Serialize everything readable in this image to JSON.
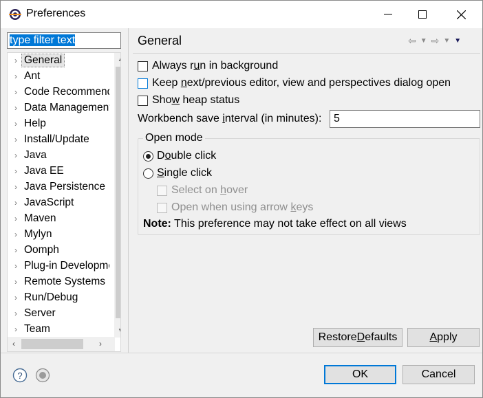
{
  "window": {
    "title": "Preferences",
    "minimize_icon": "minimize-icon",
    "maximize_icon": "maximize-icon",
    "close_icon": "close-icon"
  },
  "filter": {
    "value": "type filter text"
  },
  "tree": {
    "selected": "General",
    "items": [
      "General",
      "Ant",
      "Code Recommenders",
      "Data Management",
      "Help",
      "Install/Update",
      "Java",
      "Java EE",
      "Java Persistence",
      "JavaScript",
      "Maven",
      "Mylyn",
      "Oomph",
      "Plug-in Development",
      "Remote Systems",
      "Run/Debug",
      "Server",
      "Team"
    ]
  },
  "page": {
    "title": "General",
    "checkboxes": {
      "always_run_background": {
        "before": "Always r",
        "mnemonic": "u",
        "after": "n in background",
        "checked": false
      },
      "keep_next_prev": {
        "before": "Keep ",
        "mnemonic": "n",
        "after": "ext/previous editor, view and perspectives dialog open",
        "checked": false
      },
      "show_heap": {
        "before": "Sho",
        "mnemonic": "w",
        "after": " heap status",
        "checked": false
      }
    },
    "interval": {
      "before": "Workbench save ",
      "mnemonic": "i",
      "after": "nterval (in minutes):",
      "value": "5"
    },
    "open_mode": {
      "label": "Open mode",
      "double_click": {
        "before": "D",
        "mnemonic": "o",
        "after": "uble click",
        "checked": true
      },
      "single_click": {
        "before": "",
        "mnemonic": "S",
        "after": "ingle click",
        "checked": false
      },
      "select_on_hover": {
        "before": "Select on ",
        "mnemonic": "h",
        "after": "over",
        "enabled": false
      },
      "open_arrow_keys": {
        "before": "Open when using arrow ",
        "mnemonic": "k",
        "after": "eys",
        "enabled": false
      }
    },
    "note": {
      "bold": "Note:",
      "text": " This preference may not take effect on all views"
    }
  },
  "buttons": {
    "restore_defaults": {
      "before": "Restore ",
      "mnemonic": "D",
      "after": "efaults"
    },
    "apply": {
      "before": "",
      "mnemonic": "A",
      "after": "pply"
    },
    "ok": "OK",
    "cancel": "Cancel"
  },
  "icons": {
    "help": "help-icon",
    "info": "info-icon",
    "back": "back-arrow-icon",
    "forward": "forward-arrow-icon",
    "view_menu": "view-menu-icon"
  },
  "colors": {
    "accent": "#0078d7",
    "window_bg": "#f0f0f0",
    "disabled_text": "#8f8f8f"
  }
}
